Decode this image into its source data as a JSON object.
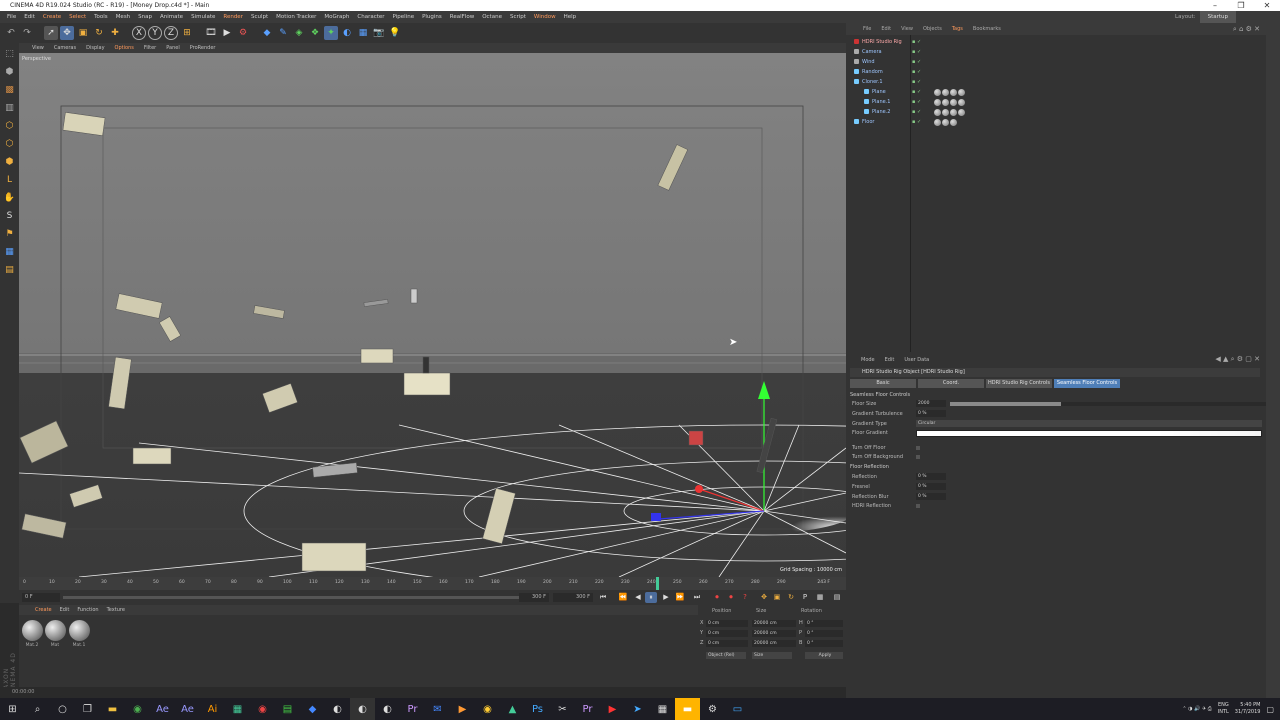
{
  "window": {
    "title": "CINEMA 4D R19.024 Studio (RC - R19) - [Money Drop.c4d *] - Main"
  },
  "menubar": {
    "items": [
      "File",
      "Edit",
      "Create",
      "Select",
      "Tools",
      "Mesh",
      "Snap",
      "Animate",
      "Simulate",
      "Render",
      "Sculpt",
      "Motion Tracker",
      "MoGraph",
      "Character",
      "Pipeline",
      "Plugins",
      "RealFlow",
      "Octane",
      "Script",
      "Window",
      "Help"
    ],
    "layout_label": "Layout:",
    "layout_value": "Startup"
  },
  "viewport": {
    "menu": [
      "View",
      "Cameras",
      "Display",
      "Filter",
      "Panel",
      "ProRender"
    ],
    "menu_extra": "Options",
    "label": "Perspective",
    "grid_spacing": "Grid Spacing : 10000 cm"
  },
  "timeline": {
    "ticks": [
      "0",
      "10",
      "20",
      "30",
      "40",
      "50",
      "60",
      "70",
      "80",
      "90",
      "100",
      "110",
      "120",
      "130",
      "140",
      "150",
      "160",
      "170",
      "180",
      "190",
      "200",
      "210",
      "220",
      "230",
      "240",
      "250",
      "260",
      "270",
      "280",
      "290"
    ],
    "current_frame": "243 F",
    "start_frame": "0 F",
    "end_frame_a": "300 F",
    "end_frame_b": "300 F"
  },
  "materials": {
    "menu": [
      "Create",
      "Edit",
      "Function",
      "Texture"
    ],
    "items": [
      {
        "label": "Mat.2"
      },
      {
        "label": "Mat"
      },
      {
        "label": "Mat.1"
      }
    ]
  },
  "coordinates": {
    "headers": [
      "Position",
      "Size",
      "Rotation"
    ],
    "rows": [
      {
        "axis": "X",
        "pos": "0 cm",
        "size": "20000 cm",
        "rot_axis": "H",
        "rot": "0 °"
      },
      {
        "axis": "Y",
        "pos": "0 cm",
        "size": "20000 cm",
        "rot_axis": "P",
        "rot": "0 °"
      },
      {
        "axis": "Z",
        "pos": "0 cm",
        "size": "20000 cm",
        "rot_axis": "B",
        "rot": "0 °"
      }
    ],
    "mode": "Object (Rel)",
    "size_mode": "Size",
    "apply": "Apply"
  },
  "status": {
    "text": "00:00:00",
    "brand": "MAXON CINEMA 4D"
  },
  "objects": {
    "menu": [
      "File",
      "Edit",
      "View",
      "Objects",
      "Tags",
      "Bookmarks"
    ],
    "items": [
      {
        "name": "HDRI Studio Rig",
        "color": "#c33",
        "selected": true
      },
      {
        "name": "Camera",
        "color": "#aaa"
      },
      {
        "name": "Wind",
        "color": "#aaa"
      },
      {
        "name": "Random",
        "color": "#7cf"
      },
      {
        "name": "Cloner.1",
        "color": "#7cf"
      },
      {
        "name": "Plane",
        "color": "#7cf"
      },
      {
        "name": "Plane.1",
        "color": "#7cf"
      },
      {
        "name": "Plane.2",
        "color": "#7cf"
      },
      {
        "name": "Floor",
        "color": "#7cf"
      }
    ]
  },
  "attributes": {
    "menu": [
      "Mode",
      "Edit",
      "User Data"
    ],
    "title": "HDRI Studio Rig Object [HDRI Studio Rig]",
    "tabs": [
      "Basic",
      "Coord.",
      "HDRI Studio Rig Controls",
      "Seamless Floor Controls"
    ],
    "active_tab": 3,
    "section1": "Seamless Floor Controls",
    "params1": [
      {
        "label": "Floor Size",
        "value": "2000",
        "slider": 0.35
      },
      {
        "label": "Gradient Turbulence",
        "value": "0 %",
        "slider": 0.0
      },
      {
        "label": "Gradient Type",
        "value": "Circular"
      },
      {
        "label": "Floor Gradient",
        "value": ""
      },
      {
        "label": "Turn Off Floor",
        "value": ""
      },
      {
        "label": "Turn Off Background",
        "value": ""
      }
    ],
    "section2": "Floor Reflection",
    "params2": [
      {
        "label": "Reflection",
        "value": "0 %"
      },
      {
        "label": "Fresnel",
        "value": "0 %"
      },
      {
        "label": "Reflection Blur",
        "value": "0 %"
      },
      {
        "label": "HDRI Reflection",
        "value": ""
      }
    ]
  },
  "taskbar": {
    "lang": "ENG",
    "region": "INTL",
    "time": "5:40 PM",
    "date": "31/7/2019"
  }
}
